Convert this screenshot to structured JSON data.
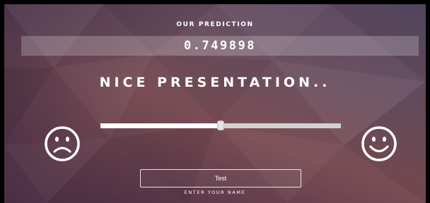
{
  "header": {
    "title": "OUR PREDICTION"
  },
  "prediction": {
    "score": "0.749898",
    "headline": "NICE PRESENTATION.."
  },
  "rating_slider": {
    "value": 0.5,
    "min": 0,
    "max": 1
  },
  "icons": {
    "left": "sad-face-icon",
    "right": "happy-face-icon"
  },
  "name_input": {
    "value": "Test",
    "label": "ENTER YOUR NAME"
  },
  "colors": {
    "text": "#ffffff",
    "track": "#d2d2d2",
    "background": "#6a4a5a"
  }
}
